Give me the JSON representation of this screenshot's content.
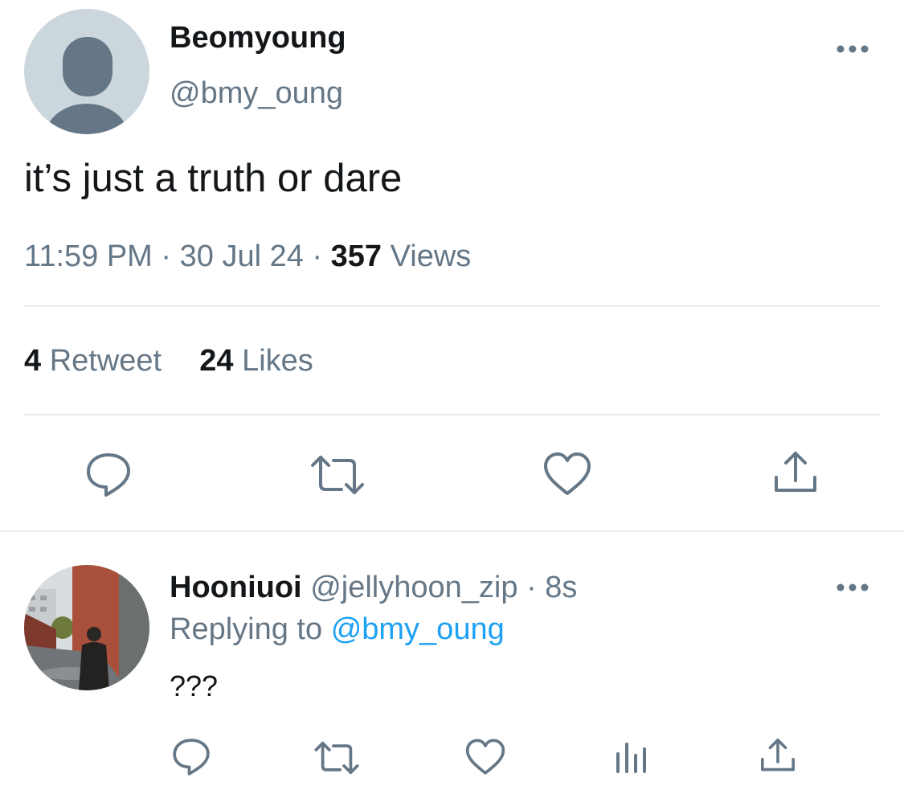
{
  "tweet": {
    "author": {
      "display_name": "Beomyoung",
      "handle": "@bmy_oung"
    },
    "text": "it’s just a truth or dare",
    "time": "11:59 PM",
    "separator": "·",
    "date": "30 Jul 24",
    "views_count": "357",
    "views_label": "Views",
    "retweet_count": "4",
    "retweet_label": "Retweet",
    "likes_count": "24",
    "likes_label": "Likes",
    "actions": [
      "reply-icon",
      "retweet-icon",
      "like-icon",
      "share-icon"
    ]
  },
  "reply": {
    "display_name": "Hooniuoi",
    "handle": "@jellyhoon_zip",
    "separator": "·",
    "age": "8s",
    "replying_prefix": "Replying to",
    "replying_to": "@bmy_oung",
    "text": "???",
    "actions": [
      "reply-icon",
      "retweet-icon",
      "like-icon",
      "analytics-icon",
      "share-icon"
    ]
  },
  "colors": {
    "primary_text": "#14171a",
    "secondary_text": "#657786",
    "link": "#1da1f2",
    "divider": "#e6ecf0",
    "icon": "#657786",
    "default_avatar_bg": "#ccd6dd",
    "default_avatar_fg": "#657786"
  }
}
